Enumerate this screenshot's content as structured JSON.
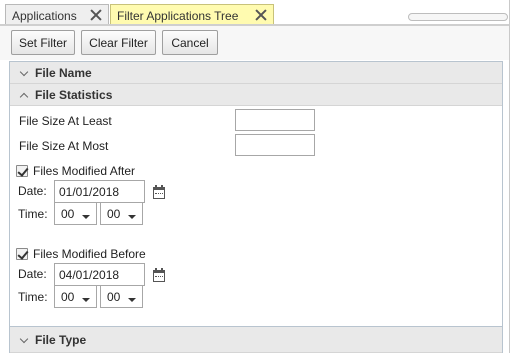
{
  "tabs": [
    {
      "label": "Applications",
      "active": false
    },
    {
      "label": "Filter Applications Tree",
      "active": true
    }
  ],
  "toolbar": {
    "set_filter": "Set Filter",
    "clear_filter": "Clear Filter",
    "cancel": "Cancel"
  },
  "sections": {
    "file_name": "File Name",
    "file_statistics": "File Statistics",
    "file_type": "File Type"
  },
  "stats": {
    "size_at_least_label": "File Size At Least",
    "size_at_least_value": "",
    "size_at_most_label": "File Size At Most",
    "size_at_most_value": ""
  },
  "modified_after": {
    "label": "Files Modified After",
    "checked": true,
    "date_label": "Date:",
    "date_value": "01/01/2018",
    "time_label": "Time:",
    "hour": "00",
    "minute": "00"
  },
  "modified_before": {
    "label": "Files Modified Before",
    "checked": true,
    "date_label": "Date:",
    "date_value": "04/01/2018",
    "time_label": "Time:",
    "hour": "00",
    "minute": "00"
  },
  "icons": {
    "tab_close": "close-icon",
    "section_collapsed": "chevron-down-icon",
    "section_expanded": "chevron-up-icon",
    "date_picker": "calendar-icon"
  },
  "colors": {
    "active_tab_bg": "#fffbb0",
    "section_header_bg": "#e9e9e9",
    "panel_border": "#b8c4cf"
  }
}
